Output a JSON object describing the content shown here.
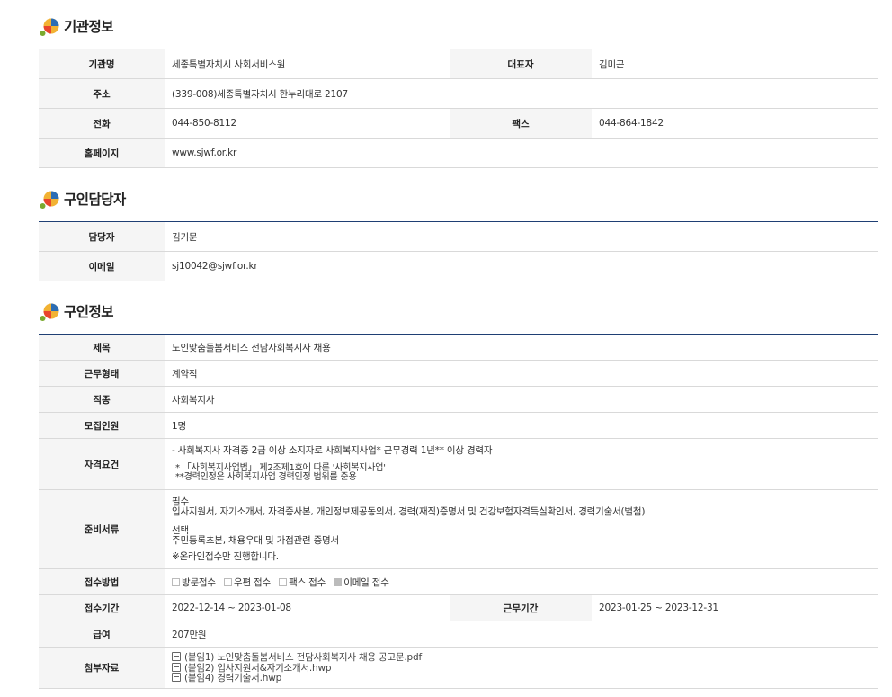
{
  "org": {
    "title": "기관정보",
    "name_label": "기관명",
    "name": "세종특별자치시 사회서비스원",
    "ceo_label": "대표자",
    "ceo": "김미곤",
    "address_label": "주소",
    "address": "(339-008)세종특별자치시 한누리대로 2107",
    "phone_label": "전화",
    "phone": "044-850-8112",
    "fax_label": "팩스",
    "fax": "044-864-1842",
    "homepage_label": "홈페이지",
    "homepage": "www.sjwf.or.kr"
  },
  "contact": {
    "title": "구인담당자",
    "manager_label": "담당자",
    "manager": "김기문",
    "email_label": "이메일",
    "email": "sj10042@sjwf.or.kr"
  },
  "job": {
    "title": "구인정보",
    "subject_label": "제목",
    "subject": "노인맞춤돌봄서비스 전담사회복지사 채용",
    "worktype_label": "근무형태",
    "worktype": "계약직",
    "occupation_label": "직종",
    "occupation": "사회복지사",
    "headcount_label": "모집인원",
    "headcount": "1명",
    "qualification_label": "자격요건",
    "qualification": {
      "line1": "- 사회복지사 자격증 2급 이상 소지자로 사회복지사업* 근무경력 1년** 이상 경력자",
      "note1": "* 「사회복지사업법」 제2조제1호에 따른 '사회복지사업'",
      "note2": "**경력인정은 사회복지사업 경력인정 범위를 준용"
    },
    "documents_label": "준비서류",
    "documents": {
      "required_title": "필수",
      "required_items": "입사지원서, 자기소개서, 자격증사본, 개인정보제공동의서, 경력(재직)증명서 및 건강보험자격득실확인서, 경력기술서(별첨)",
      "optional_title": "선택",
      "optional_items": "주민등록초본, 채용우대 및 가점관련 증명서",
      "note": "※온라인접수만 진행합니다."
    },
    "method_label": "접수방법",
    "methods": [
      {
        "label": "방문접수",
        "checked": false
      },
      {
        "label": "우편 접수",
        "checked": false
      },
      {
        "label": "팩스 접수",
        "checked": false
      },
      {
        "label": "이메일 접수",
        "checked": true
      }
    ],
    "period_label": "접수기간",
    "period": "2022-12-14 ~ 2023-01-08",
    "workperiod_label": "근무기간",
    "workperiod": "2023-01-25 ~ 2023-12-31",
    "salary_label": "급여",
    "salary": "207만원",
    "attachments_label": "첨부자료",
    "attachments": [
      "(붙임1) 노인맞춤돌봄서비스 전담사회복지사 채용 공고문.pdf",
      "(붙임2) 입사지원서&자기소개서.hwp",
      "(붙임4) 경력기술서.hwp"
    ]
  }
}
